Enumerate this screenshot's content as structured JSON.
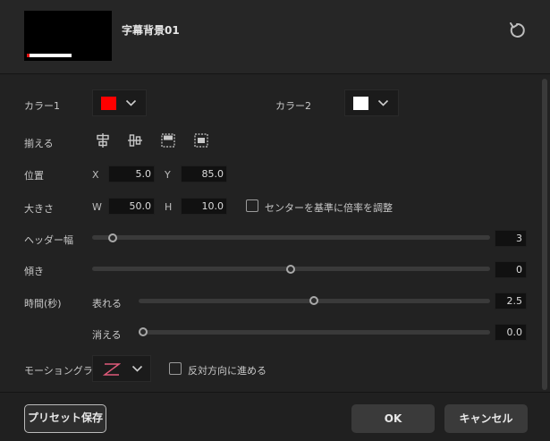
{
  "header": {
    "title": "字幕背景01"
  },
  "color1": {
    "label": "カラー1",
    "value": "#ff0000"
  },
  "color2": {
    "label": "カラー2",
    "value": "#ffffff"
  },
  "align": {
    "label": "揃える"
  },
  "position": {
    "label": "位置",
    "x_label": "X",
    "x_value": "5.0",
    "y_label": "Y",
    "y_value": "85.0"
  },
  "size": {
    "label": "大きさ",
    "w_label": "W",
    "w_value": "50.0",
    "h_label": "H",
    "h_value": "10.0",
    "center_scale_label": "センターを基準に倍率を調整",
    "center_scale_checked": false
  },
  "header_width": {
    "label": "ヘッダー幅",
    "value": "3"
  },
  "tilt": {
    "label": "傾き",
    "value": "0"
  },
  "time": {
    "label": "時間(秒)",
    "appear_label": "表れる",
    "appear_value": "2.5",
    "disappear_label": "消える",
    "disappear_value": "0.0"
  },
  "motion": {
    "label": "モーショングラフ",
    "reverse_label": "反対方向に進める",
    "reverse_checked": false,
    "graph_color": "#e05a7a"
  },
  "footer": {
    "preset_save_label": "プリセット保存",
    "ok_label": "OK",
    "cancel_label": "キャンセル"
  }
}
